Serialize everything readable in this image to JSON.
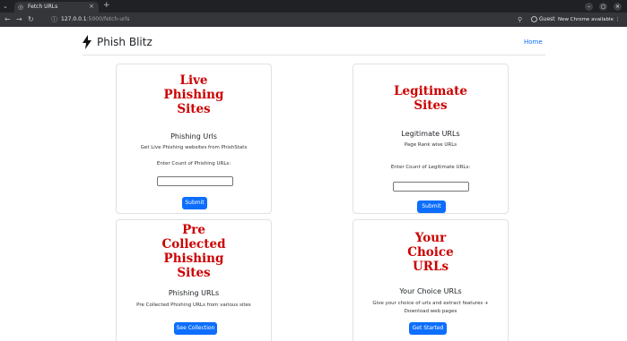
{
  "browser": {
    "tab_title": "Fetch URLs",
    "url_host": "127.0.0.1",
    "url_path": ":5000/fetch-urls",
    "profile_label": "Guest",
    "update_label": "New Chrome available"
  },
  "nav": {
    "brand": "Phish Blitz",
    "home": "Home"
  },
  "cards": {
    "live": {
      "title_lines": [
        "Live",
        "Phishing",
        "Sites"
      ],
      "subtitle": "Phishing Urls",
      "description": "Get Live Phishing websites from PhishStats",
      "input_label": "Enter Count of Phishing URLs:",
      "button": "Submit"
    },
    "legit": {
      "title_lines": [
        "Legitimate",
        "Sites"
      ],
      "subtitle": "Legitimate URLs",
      "description": "Page Rank wise URLs",
      "input_label": "Enter Count of Legitimate URLs:",
      "button": "Submit"
    },
    "precollected": {
      "title_lines": [
        "Pre",
        "Collected",
        "Phishing",
        "Sites"
      ],
      "subtitle": "Phishing URLs",
      "description": "Pre Collected Phishing URLs from various sites",
      "button": "See Collection"
    },
    "choice": {
      "title_lines": [
        "Your",
        "Choice",
        "URLs"
      ],
      "subtitle": "Your Choice URLs",
      "description_lines": [
        "Give your choice of urls and extract features +",
        "Download web pages"
      ],
      "button": "Get Started"
    }
  },
  "colors": {
    "title_red": "#cc0000",
    "primary_blue": "#0d6efd",
    "chrome_dark": "#202124",
    "chrome_toolbar": "#35363a"
  }
}
